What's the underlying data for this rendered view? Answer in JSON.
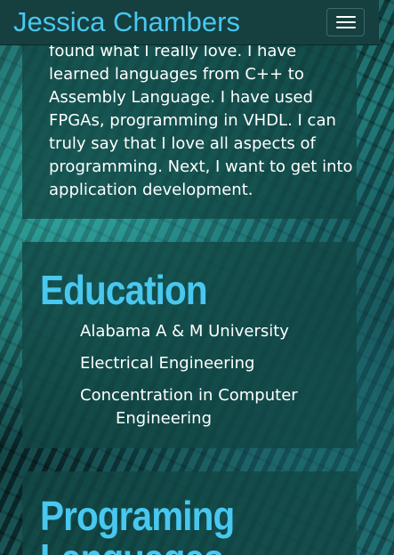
{
  "navbar": {
    "brand": "Jessica Chambers",
    "menu_icon": "hamburger-menu-icon"
  },
  "about": {
    "text": "found what I really love. I have\nlearned languages from C++ to\nAssembly Language. I have used\nFPGAs, programming in VHDL. I can\ntruly say that I love all aspects of\nprogramming. Next, I want to get into\napplication development."
  },
  "education": {
    "title": "Education",
    "items": [
      "Alabama A & M University",
      "Electrical Engineering",
      "Concentration in Computer Engineering"
    ]
  },
  "programming": {
    "title": "Programing\nLanguages"
  },
  "colors": {
    "accent": "#48c8f0",
    "navbar": "#163f3f",
    "panel": "#124644"
  }
}
